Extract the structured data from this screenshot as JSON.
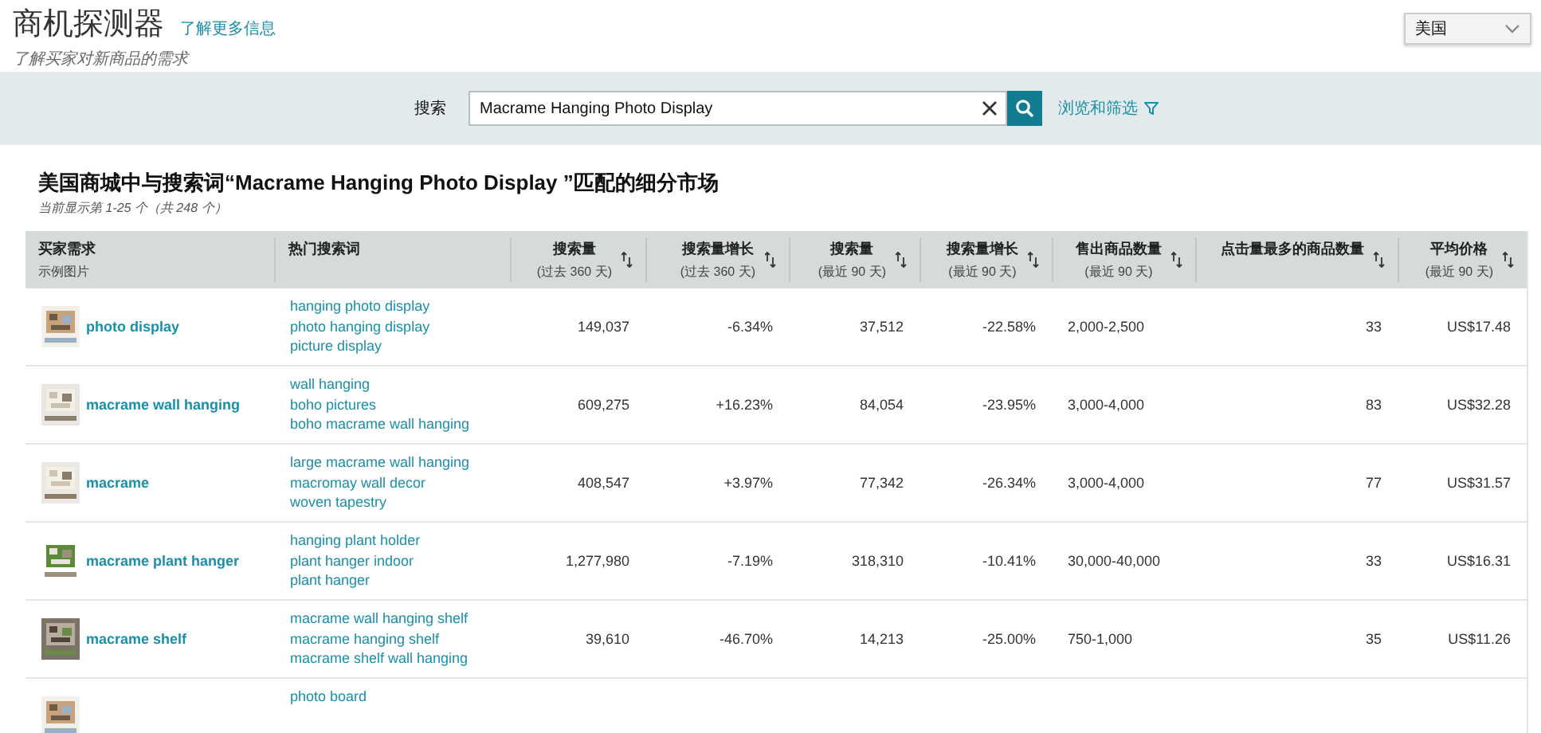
{
  "header": {
    "title": "商机探测器",
    "learn_more": "了解更多信息",
    "subtitle": "了解买家对新商品的需求",
    "marketplace": "美国"
  },
  "search": {
    "label": "搜索",
    "value": "Macrame Hanging Photo Display",
    "browse": "浏览和筛选"
  },
  "results": {
    "title": "美国商城中与搜索词“Macrame Hanging Photo Display ”匹配的细分市场",
    "count": "当前显示第 1-25 个（共 248 个）"
  },
  "table": {
    "columns": [
      {
        "title": "买家需求",
        "sub": "示例图片",
        "sortable": false
      },
      {
        "title": "热门搜索词",
        "sortable": false
      },
      {
        "title": "搜索量",
        "sub": "(过去 360 天)",
        "sortable": true
      },
      {
        "title": "搜索量增长",
        "sub": "(过去 360 天)",
        "sortable": true
      },
      {
        "title": "搜索量",
        "sub": "(最近 90 天)",
        "sortable": true
      },
      {
        "title": "搜索量增长",
        "sub": "(最近 90 天)",
        "sortable": true
      },
      {
        "title": "售出商品数量",
        "sub": "(最近 90 天)",
        "sortable": true
      },
      {
        "title": "点击量最多的商品数量",
        "sortable": true
      },
      {
        "title": "平均价格",
        "sub": "(最近 90 天)",
        "sortable": true
      }
    ],
    "rows": [
      {
        "demand": "photo display",
        "keywords": [
          "hanging photo display",
          "photo hanging display",
          "picture display"
        ],
        "metrics": [
          "149,037",
          "-6.34%",
          "37,512",
          "-22.58%",
          "2,000-2,500",
          "33",
          "US$17.48"
        ]
      },
      {
        "demand": "macrame wall hanging",
        "keywords": [
          "wall hanging",
          "boho pictures",
          "boho macrame wall hanging"
        ],
        "metrics": [
          "609,275",
          "+16.23%",
          "84,054",
          "-23.95%",
          "3,000-4,000",
          "83",
          "US$32.28"
        ]
      },
      {
        "demand": "macrame",
        "keywords": [
          "large macrame wall hanging",
          "macromay wall decor",
          "woven tapestry"
        ],
        "metrics": [
          "408,547",
          "+3.97%",
          "77,342",
          "-26.34%",
          "3,000-4,000",
          "77",
          "US$31.57"
        ]
      },
      {
        "demand": "macrame plant hanger",
        "keywords": [
          "hanging plant holder",
          "plant hanger indoor",
          "plant hanger"
        ],
        "metrics": [
          "1,277,980",
          "-7.19%",
          "318,310",
          "-10.41%",
          "30,000-40,000",
          "33",
          "US$16.31"
        ]
      },
      {
        "demand": "macrame shelf",
        "keywords": [
          "macrame wall hanging shelf",
          "macrame hanging shelf",
          "macrame shelf wall hanging"
        ],
        "metrics": [
          "39,610",
          "-46.70%",
          "14,213",
          "-25.00%",
          "750-1,000",
          "35",
          "US$11.26"
        ]
      },
      {
        "keywords": [
          "photo board"
        ]
      }
    ]
  }
}
